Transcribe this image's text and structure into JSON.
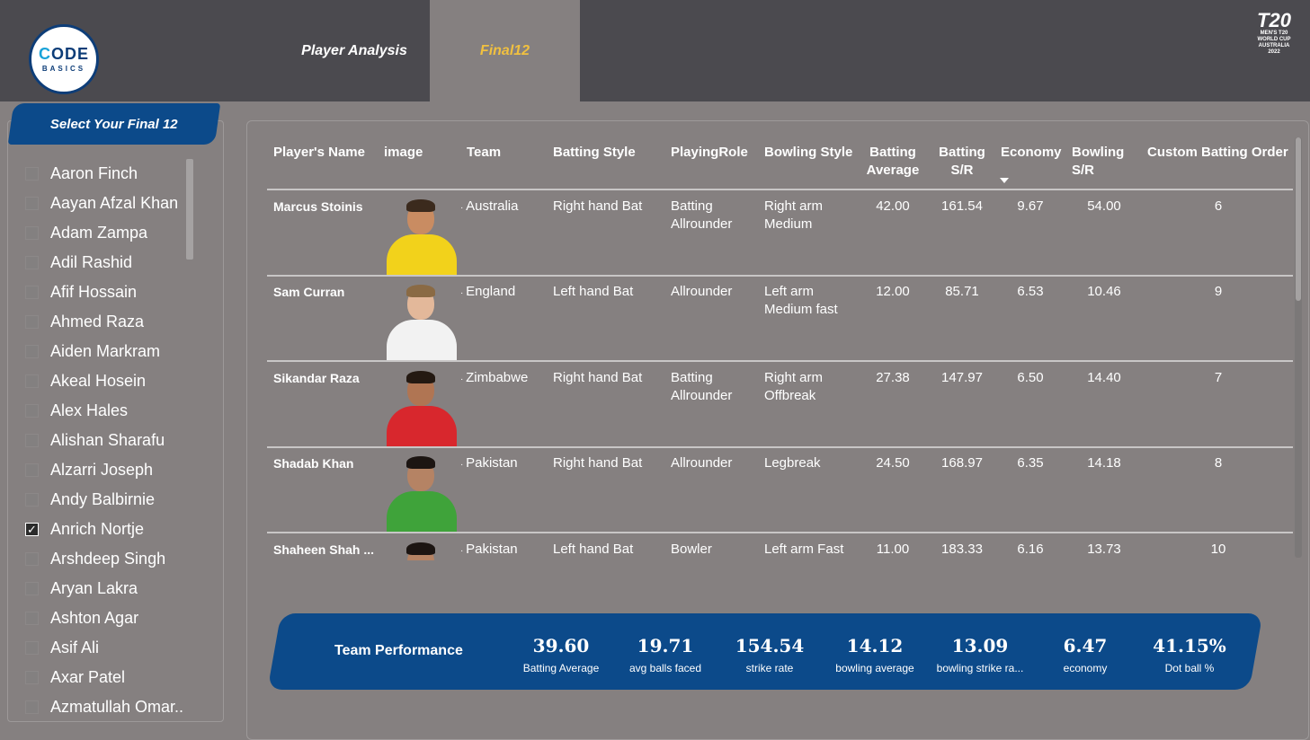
{
  "header": {
    "logo_line1_c": "C",
    "logo_line1": "ODE",
    "logo_line2": "BASICS",
    "tabs": [
      {
        "label": "Player Analysis"
      },
      {
        "label": "Final12"
      }
    ],
    "event_logo_text": "MEN'S T20 WORLD CUP AUSTRALIA 2022"
  },
  "sidebar": {
    "title": "Select Your Final 12",
    "players": [
      {
        "name": "Aaron Finch",
        "checked": false
      },
      {
        "name": "Aayan Afzal Khan",
        "checked": false
      },
      {
        "name": "Adam Zampa",
        "checked": false
      },
      {
        "name": "Adil Rashid",
        "checked": false
      },
      {
        "name": "Afif Hossain",
        "checked": false
      },
      {
        "name": "Ahmed Raza",
        "checked": false
      },
      {
        "name": "Aiden Markram",
        "checked": false
      },
      {
        "name": "Akeal Hosein",
        "checked": false
      },
      {
        "name": "Alex Hales",
        "checked": false
      },
      {
        "name": "Alishan Sharafu",
        "checked": false
      },
      {
        "name": "Alzarri Joseph",
        "checked": false
      },
      {
        "name": "Andy Balbirnie",
        "checked": false
      },
      {
        "name": "Anrich Nortje",
        "checked": true
      },
      {
        "name": "Arshdeep Singh",
        "checked": false
      },
      {
        "name": "Aryan Lakra",
        "checked": false
      },
      {
        "name": "Ashton Agar",
        "checked": false
      },
      {
        "name": "Asif Ali",
        "checked": false
      },
      {
        "name": "Axar Patel",
        "checked": false
      },
      {
        "name": "Azmatullah Omar..",
        "checked": false
      }
    ]
  },
  "table": {
    "headers": {
      "name": "Player's Name",
      "image": "image",
      "team": "Team",
      "batting_style": "Batting Style",
      "playing_role": "PlayingRole",
      "bowling_style": "Bowling Style",
      "batting_avg_1": "Batting",
      "batting_avg_2": "Average",
      "batting_sr_1": "Batting",
      "batting_sr_2": "S/R",
      "economy": "Economy",
      "bowling_sr_1": "Bowling",
      "bowling_sr_2": "S/R",
      "custom_order": "Custom Batting Order"
    },
    "rows": [
      {
        "name": "Marcus Stoinis",
        "team": "Australia",
        "batting_style": "Right hand Bat",
        "role1": "Batting",
        "role2": "Allrounder",
        "bowl1": "Right arm",
        "bowl2": "Medium",
        "bat_avg": "42.00",
        "bat_sr": "161.54",
        "economy": "9.67",
        "bowl_sr": "54.00",
        "order": "6",
        "shirt": "#f2d21b",
        "skin": "#c98c62",
        "hair": "#3b2a1d"
      },
      {
        "name": "Sam Curran",
        "team": "England",
        "batting_style": "Left hand Bat",
        "role1": "Allrounder",
        "role2": "",
        "bowl1": "Left arm",
        "bowl2": "Medium fast",
        "bat_avg": "12.00",
        "bat_sr": "85.71",
        "economy": "6.53",
        "bowl_sr": "10.46",
        "order": "9",
        "shirt": "#f2f2f2",
        "skin": "#e3b89a",
        "hair": "#8a6a44"
      },
      {
        "name": "Sikandar Raza",
        "team": "Zimbabwe",
        "batting_style": "Right hand Bat",
        "role1": "Batting",
        "role2": "Allrounder",
        "bowl1": "Right arm",
        "bowl2": "Offbreak",
        "bat_avg": "27.38",
        "bat_sr": "147.97",
        "economy": "6.50",
        "bowl_sr": "14.40",
        "order": "7",
        "shirt": "#d8272d",
        "skin": "#b07553",
        "hair": "#241912"
      },
      {
        "name": "Shadab Khan",
        "team": "Pakistan",
        "batting_style": "Right hand Bat",
        "role1": "Allrounder",
        "role2": "",
        "bowl1": "Legbreak",
        "bowl2": "",
        "bat_avg": "24.50",
        "bat_sr": "168.97",
        "economy": "6.35",
        "bowl_sr": "14.18",
        "order": "8",
        "shirt": "#3fa33a",
        "skin": "#b58364",
        "hair": "#1c1512"
      },
      {
        "name": "Shaheen Shah ...",
        "team": "Pakistan",
        "batting_style": "Left hand Bat",
        "role1": "Bowler",
        "role2": "",
        "bowl1": "Left arm Fast",
        "bowl2": "",
        "bat_avg": "11.00",
        "bat_sr": "183.33",
        "economy": "6.16",
        "bowl_sr": "13.73",
        "order": "10",
        "shirt": "#3fa33a",
        "skin": "#b58364",
        "hair": "#1c1512"
      }
    ]
  },
  "team_performance": {
    "title": "Team Performance",
    "kpis": [
      {
        "value": "39.60",
        "label": "Batting Average"
      },
      {
        "value": "19.71",
        "label": "avg balls faced"
      },
      {
        "value": "154.54",
        "label": "strike rate"
      },
      {
        "value": "14.12",
        "label": "bowling average"
      },
      {
        "value": "13.09",
        "label": "bowling strike ra..."
      },
      {
        "value": "6.47",
        "label": "economy"
      },
      {
        "value": "41.15%",
        "label": "Dot ball %"
      }
    ]
  }
}
